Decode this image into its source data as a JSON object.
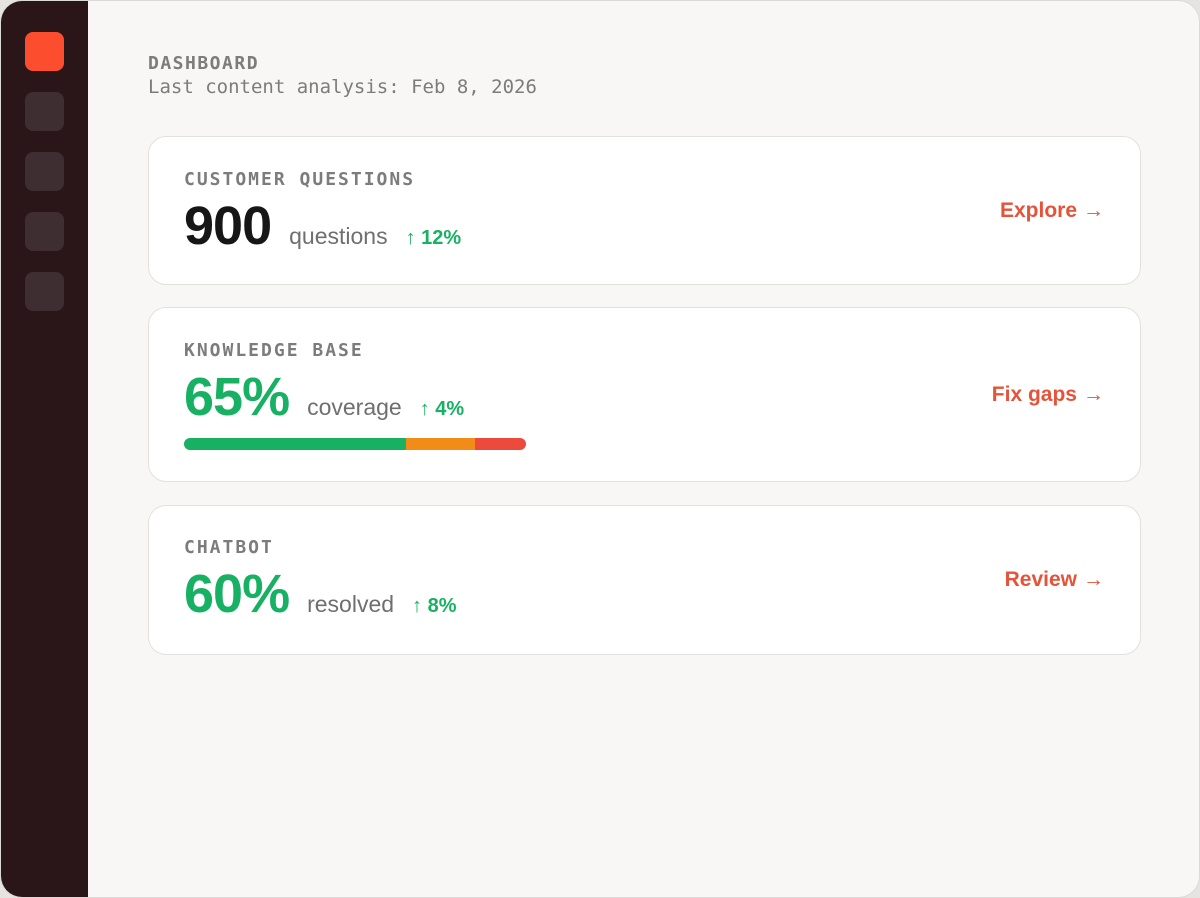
{
  "sidebar": {
    "items": [
      {
        "id": "nav-1",
        "active": true
      },
      {
        "id": "nav-2",
        "active": false
      },
      {
        "id": "nav-3",
        "active": false
      },
      {
        "id": "nav-4",
        "active": false
      },
      {
        "id": "nav-5",
        "active": false
      }
    ],
    "accent_color": "#fc4e2e",
    "background_color": "#2a1519"
  },
  "header": {
    "title": "DASHBOARD",
    "subtitle": "Last content analysis: Feb 8, 2026"
  },
  "cards": {
    "customer_questions": {
      "label": "CUSTOMER QUESTIONS",
      "value": "900",
      "unit": "questions",
      "delta": "↑ 12%",
      "action": "Explore",
      "action_icon": "→"
    },
    "knowledge_base": {
      "label": "KNOWLEDGE BASE",
      "value": "65%",
      "unit": "coverage",
      "delta": "↑ 4%",
      "action": "Fix gaps",
      "action_icon": "→",
      "bar_segments": [
        {
          "name": "covered",
          "fraction": 0.65,
          "color": "#18b163"
        },
        {
          "name": "partial",
          "fraction": 0.2,
          "color": "#f28c18"
        },
        {
          "name": "missing",
          "fraction": 0.15,
          "color": "#ec4a3c"
        }
      ]
    },
    "chatbot": {
      "label": "CHATBOT",
      "value": "60%",
      "unit": "resolved",
      "delta": "↑ 8%",
      "action": "Review",
      "action_icon": "→"
    }
  },
  "colors": {
    "positive": "#18b163",
    "action": "#e5533a",
    "muted_text": "#7c7c7c"
  }
}
